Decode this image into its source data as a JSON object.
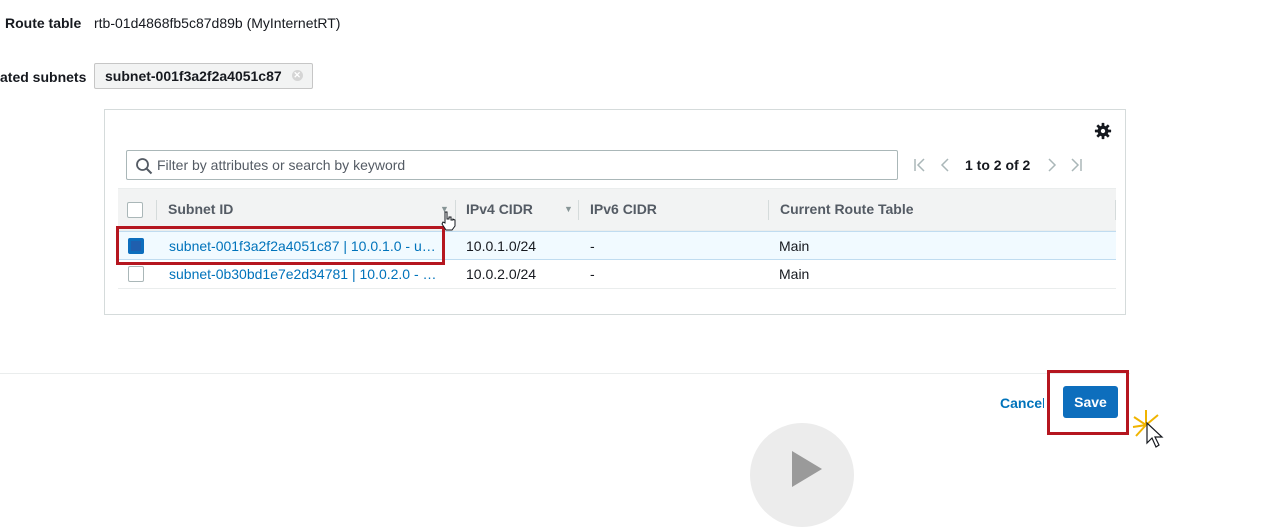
{
  "form": {
    "route_table_label": "Route table",
    "route_table_value": "rtb-01d4868fb5c87d89b (MyInternetRT)",
    "associated_subnets_label": "ated subnets",
    "chip_label": "subnet-001f3a2f2a4051c87",
    "chip_remove": "✕"
  },
  "table": {
    "search_placeholder": "Filter by attributes or search by keyword",
    "pagination": "1 to 2 of 2",
    "columns": [
      "Subnet ID",
      "IPv4 CIDR",
      "IPv6 CIDR",
      "Current Route Table"
    ],
    "rows": [
      {
        "subnet": "subnet-001f3a2f2a4051c87 | 10.0.1.0 - u…",
        "ipv4": "10.0.1.0/24",
        "ipv6": "-",
        "route_table": "Main",
        "selected": true
      },
      {
        "subnet": "subnet-0b30bd1e7e2d34781 | 10.0.2.0 - …",
        "ipv4": "10.0.2.0/24",
        "ipv6": "-",
        "route_table": "Main",
        "selected": false
      }
    ]
  },
  "footer": {
    "cancel_label": "Cancel",
    "save_label": "Save"
  },
  "icons": {
    "gear": "gear-icon",
    "search": "search-icon",
    "first": "first-page-icon",
    "prev": "prev-page-icon",
    "next": "next-page-icon",
    "last": "last-page-icon",
    "play": "play-icon",
    "cursor": "cursor-icon"
  },
  "colors": {
    "accent": "#0d6ebd",
    "link": "#0073bb",
    "highlight": "#b5161f",
    "selected_row": "#f1faff"
  }
}
